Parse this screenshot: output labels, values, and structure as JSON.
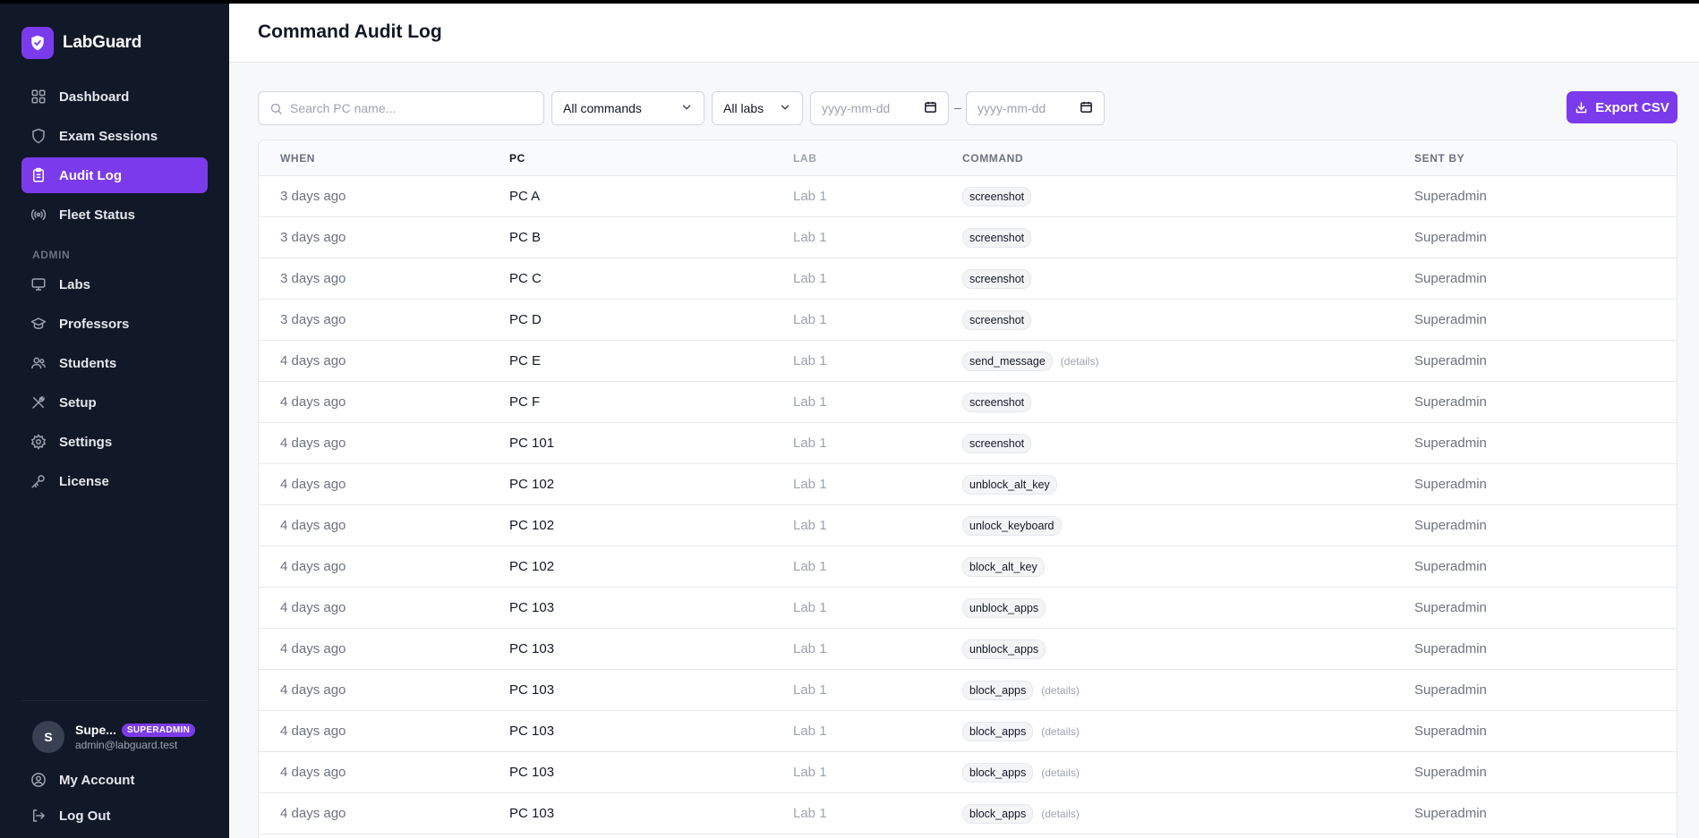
{
  "brand": {
    "name": "LabGuard"
  },
  "sidebar": {
    "nav": [
      {
        "label": "Dashboard",
        "icon": "dashboard-icon",
        "active": false
      },
      {
        "label": "Exam Sessions",
        "icon": "shield-icon",
        "active": false
      },
      {
        "label": "Audit Log",
        "icon": "clipboard-icon",
        "active": true
      },
      {
        "label": "Fleet Status",
        "icon": "broadcast-icon",
        "active": false
      }
    ],
    "admin_label": "ADMIN",
    "admin_nav": [
      {
        "label": "Labs",
        "icon": "monitor-icon"
      },
      {
        "label": "Professors",
        "icon": "graduation-cap-icon"
      },
      {
        "label": "Students",
        "icon": "users-icon"
      },
      {
        "label": "Setup",
        "icon": "tools-icon"
      },
      {
        "label": "Settings",
        "icon": "gear-icon"
      },
      {
        "label": "License",
        "icon": "key-icon"
      }
    ],
    "user": {
      "initial": "S",
      "name": "Supe...",
      "role": "SUPERADMIN",
      "email": "admin@labguard.test"
    },
    "bottom": [
      {
        "label": "My Account",
        "icon": "user-circle-icon"
      },
      {
        "label": "Log Out",
        "icon": "logout-icon"
      }
    ]
  },
  "page": {
    "title": "Command Audit Log"
  },
  "filters": {
    "search_placeholder": "Search PC name...",
    "command_filter": "All commands",
    "lab_filter": "All labs",
    "date_from_placeholder": "yyyy-mm-dd",
    "date_to_placeholder": "yyyy-mm-dd",
    "date_separator": "–",
    "export_label": "Export CSV"
  },
  "table": {
    "headers": {
      "when": "WHEN",
      "pc": "PC",
      "lab": "LAB",
      "command": "COMMAND",
      "sent_by": "SENT BY"
    },
    "details_label": "(details)",
    "rows": [
      {
        "when": "3 days ago",
        "pc": "PC A",
        "lab": "Lab 1",
        "command": "screenshot",
        "details": false,
        "sent_by": "Superadmin"
      },
      {
        "when": "3 days ago",
        "pc": "PC B",
        "lab": "Lab 1",
        "command": "screenshot",
        "details": false,
        "sent_by": "Superadmin"
      },
      {
        "when": "3 days ago",
        "pc": "PC C",
        "lab": "Lab 1",
        "command": "screenshot",
        "details": false,
        "sent_by": "Superadmin"
      },
      {
        "when": "3 days ago",
        "pc": "PC D",
        "lab": "Lab 1",
        "command": "screenshot",
        "details": false,
        "sent_by": "Superadmin"
      },
      {
        "when": "4 days ago",
        "pc": "PC E",
        "lab": "Lab 1",
        "command": "send_message",
        "details": true,
        "sent_by": "Superadmin"
      },
      {
        "when": "4 days ago",
        "pc": "PC F",
        "lab": "Lab 1",
        "command": "screenshot",
        "details": false,
        "sent_by": "Superadmin"
      },
      {
        "when": "4 days ago",
        "pc": "PC 101",
        "lab": "Lab 1",
        "command": "screenshot",
        "details": false,
        "sent_by": "Superadmin"
      },
      {
        "when": "4 days ago",
        "pc": "PC 102",
        "lab": "Lab 1",
        "command": "unblock_alt_key",
        "details": false,
        "sent_by": "Superadmin"
      },
      {
        "when": "4 days ago",
        "pc": "PC 102",
        "lab": "Lab 1",
        "command": "unlock_keyboard",
        "details": false,
        "sent_by": "Superadmin"
      },
      {
        "when": "4 days ago",
        "pc": "PC 102",
        "lab": "Lab 1",
        "command": "block_alt_key",
        "details": false,
        "sent_by": "Superadmin"
      },
      {
        "when": "4 days ago",
        "pc": "PC 103",
        "lab": "Lab 1",
        "command": "unblock_apps",
        "details": false,
        "sent_by": "Superadmin"
      },
      {
        "when": "4 days ago",
        "pc": "PC 103",
        "lab": "Lab 1",
        "command": "unblock_apps",
        "details": false,
        "sent_by": "Superadmin"
      },
      {
        "when": "4 days ago",
        "pc": "PC 103",
        "lab": "Lab 1",
        "command": "block_apps",
        "details": true,
        "sent_by": "Superadmin"
      },
      {
        "when": "4 days ago",
        "pc": "PC 103",
        "lab": "Lab 1",
        "command": "block_apps",
        "details": true,
        "sent_by": "Superadmin"
      },
      {
        "when": "4 days ago",
        "pc": "PC 103",
        "lab": "Lab 1",
        "command": "block_apps",
        "details": true,
        "sent_by": "Superadmin"
      },
      {
        "when": "4 days ago",
        "pc": "PC 103",
        "lab": "Lab 1",
        "command": "block_apps",
        "details": true,
        "sent_by": "Superadmin"
      }
    ]
  },
  "colors": {
    "accent": "#7c3aed",
    "sidebar_bg": "#111827"
  }
}
